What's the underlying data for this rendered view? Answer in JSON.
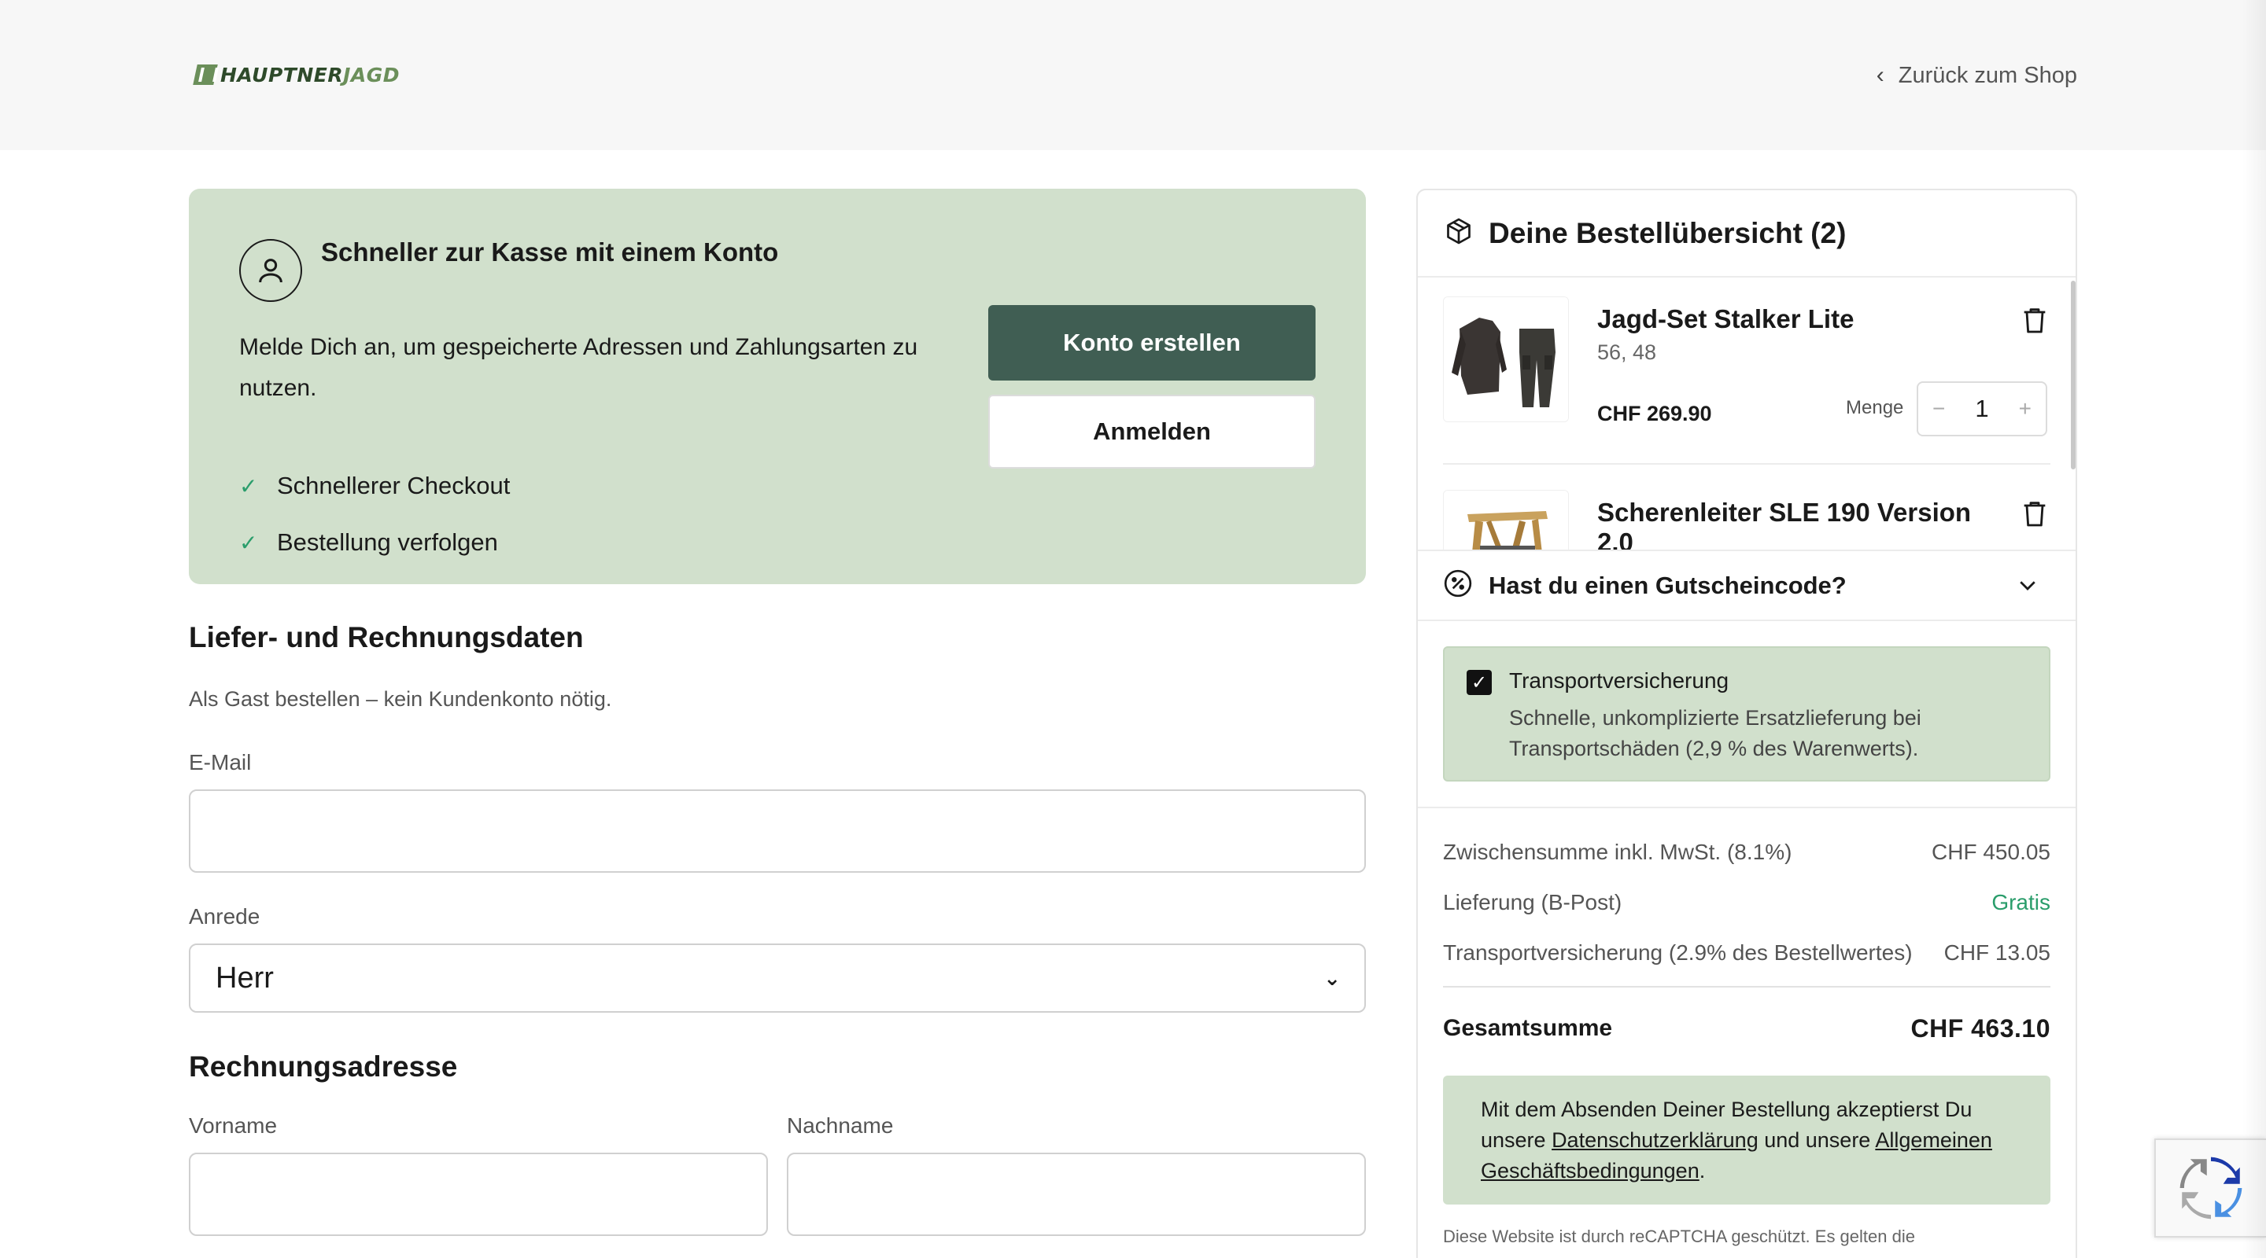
{
  "header": {
    "logo_part1": "HAUPTNER",
    "logo_part2": "JAGD",
    "back_link": "Zurück zum Shop"
  },
  "account_box": {
    "title": "Schneller zur Kasse mit einem Konto",
    "description": "Melde Dich an, um gespeicherte Adressen und Zahlungsarten zu nutzen.",
    "benefits": [
      "Schnellerer Checkout",
      "Bestellung verfolgen"
    ],
    "create_button": "Konto erstellen",
    "login_button": "Anmelden"
  },
  "form": {
    "section_title": "Liefer- und Rechnungsdaten",
    "guest_note": "Als Gast bestellen – kein Kundenkonto nötig.",
    "email_label": "E-Mail",
    "email_value": "",
    "salutation_label": "Anrede",
    "salutation_value": "Herr",
    "billing_title": "Rechnungsadresse",
    "firstname_label": "Vorname",
    "lastname_label": "Nachname"
  },
  "summary": {
    "title": "Deine Bestellübersicht (2)",
    "items": [
      {
        "name": "Jagd-Set Stalker Lite",
        "variant": "56, 48",
        "price": "CHF 269.90",
        "qty_label": "Menge",
        "qty": "1"
      },
      {
        "name": "Scherenleiter SLE 190 Version 2.0"
      }
    ],
    "coupon_label": "Hast du einen Gutscheincode?",
    "insurance": {
      "title": "Transportversicherung",
      "description": "Schnelle, unkomplizierte Ersatzlieferung bei Transportschäden (2,9 % des Warenwerts).",
      "checked": true
    },
    "lines": [
      {
        "label": "Zwischensumme inkl. MwSt. (8.1%)",
        "value": "CHF 450.05"
      },
      {
        "label": "Lieferung (B-Post)",
        "value": "Gratis"
      },
      {
        "label": "Transportversicherung (2.9% des Bestellwertes)",
        "value": "CHF 13.05"
      }
    ],
    "total_label": "Gesamtsumme",
    "total_value": "CHF 463.10",
    "legal": {
      "prefix": "Mit dem Absenden Deiner Bestellung akzeptierst Du unsere ",
      "privacy_link": "Datenschutzerklärung",
      "middle": " und unsere ",
      "terms_link": "Allgemeinen Geschäftsbedingungen",
      "suffix": "."
    },
    "captcha_note": "Diese Website ist durch reCAPTCHA geschützt. Es gelten die"
  },
  "colors": {
    "accent_green": "#405e53",
    "soft_green": "#d1e0cc",
    "success_green": "#2a9d6b"
  }
}
